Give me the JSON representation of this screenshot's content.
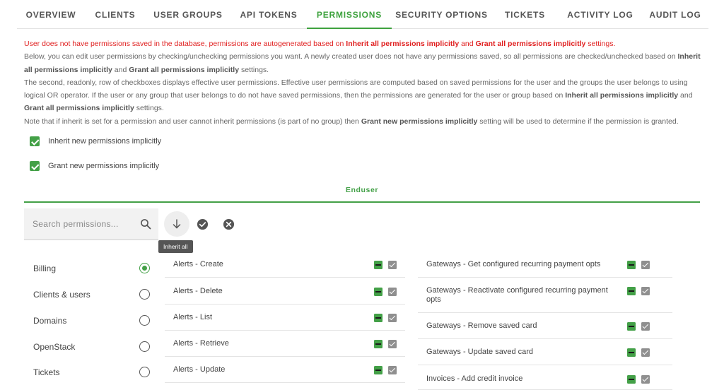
{
  "tabs": [
    {
      "label": "OVERVIEW",
      "active": false
    },
    {
      "label": "CLIENTS",
      "active": false
    },
    {
      "label": "USER GROUPS",
      "active": false
    },
    {
      "label": "API TOKENS",
      "active": false
    },
    {
      "label": "PERMISSIONS",
      "active": true
    },
    {
      "label": "SECURITY OPTIONS",
      "active": false
    },
    {
      "label": "TICKETS",
      "active": false
    },
    {
      "label": "ACTIVITY LOG",
      "active": false
    },
    {
      "label": "AUDIT LOG",
      "active": false
    }
  ],
  "notes": {
    "warning_prefix": "User does not have permissions saved in the database, permissions are autogenerated based on ",
    "inherit_all": "Inherit all permissions implicitly",
    "and": " and ",
    "grant_all": "Grant all permissions implicitly",
    "settings": " settings.",
    "p2_start": "Below, you can edit user permissions by checking/unchecking permissions you want. A newly created user does not have any permissions saved, so all permissions are checked/unchecked based on ",
    "p3_start": "The second, readonly, row of checkboxes displays effective user permissions. Effective user permissions are computed based on saved permissions for the user and the groups the user belongs to using logical OR operator. If the user or any group that user belongs to do not have saved permissions, then the permissions are generated for the user or group based on ",
    "p4_start": "Note that if inherit is set for a permission and user cannot inherit permissions (is part of no group) then ",
    "grant_new": "Grant new permissions implicitly",
    "p4_end": " setting will be used to determine if the permission is granted."
  },
  "options": {
    "inherit_new": {
      "label": "Inherit new permissions implicitly",
      "checked": true
    },
    "grant_new": {
      "label": "Grant new permissions implicitly",
      "checked": true
    }
  },
  "section": {
    "title": "Enduser"
  },
  "search": {
    "placeholder": "Search permissions..."
  },
  "toolbar": {
    "inherit_tooltip": "Inherit all"
  },
  "categories": [
    {
      "label": "Billing",
      "selected": true
    },
    {
      "label": "Clients & users",
      "selected": false
    },
    {
      "label": "Domains",
      "selected": false
    },
    {
      "label": "OpenStack",
      "selected": false
    },
    {
      "label": "Tickets",
      "selected": false
    }
  ],
  "permissions_left": [
    {
      "label": "Alerts - Create"
    },
    {
      "label": "Alerts - Delete"
    },
    {
      "label": "Alerts - List"
    },
    {
      "label": "Alerts - Retrieve"
    },
    {
      "label": "Alerts - Update"
    }
  ],
  "permissions_right": [
    {
      "label": "Gateways - Get configured recurring payment opts"
    },
    {
      "label": "Gateways - Reactivate configured recurring payment opts"
    },
    {
      "label": "Gateways - Remove saved card"
    },
    {
      "label": "Gateways - Update saved card"
    },
    {
      "label": "Invoices - Add credit invoice"
    }
  ],
  "colors": {
    "accent": "#43a047",
    "warning": "#e02020",
    "readonly": "#8f8f8f"
  }
}
